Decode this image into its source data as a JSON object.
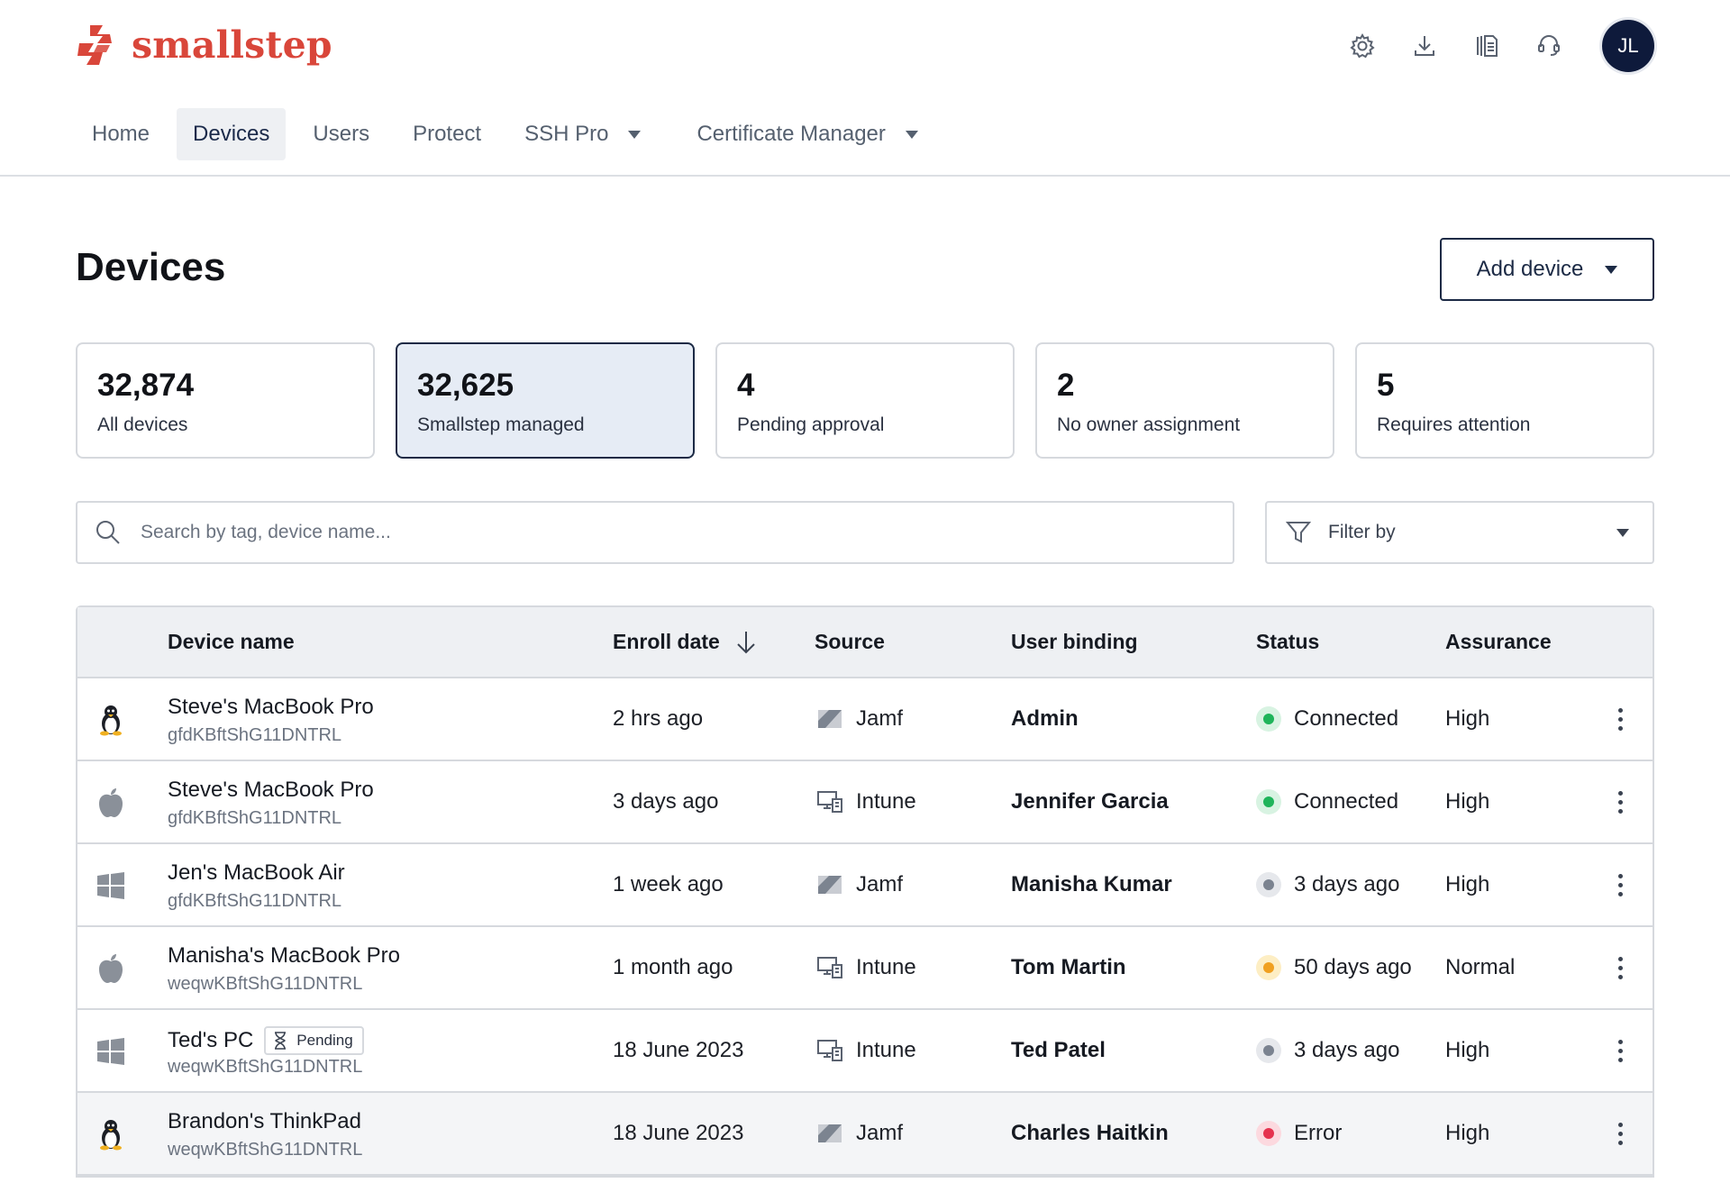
{
  "brand": {
    "name": "smallstep",
    "color": "#d9463a"
  },
  "header": {
    "icons": [
      "gear-icon",
      "download-icon",
      "docs-icon",
      "support-icon"
    ],
    "avatar_initials": "JL"
  },
  "nav": {
    "items": [
      {
        "label": "Home"
      },
      {
        "label": "Devices"
      },
      {
        "label": "Users"
      },
      {
        "label": "Protect"
      },
      {
        "label": "SSH Pro"
      },
      {
        "label": "Certificate Manager"
      }
    ],
    "active": "Devices"
  },
  "page": {
    "title": "Devices",
    "add_device_label": "Add device"
  },
  "stats": [
    {
      "value": "32,874",
      "label": "All devices"
    },
    {
      "value": "32,625",
      "label": "Smallstep managed"
    },
    {
      "value": "4",
      "label": "Pending approval"
    },
    {
      "value": "2",
      "label": "No owner assignment"
    },
    {
      "value": "5",
      "label": "Requires attention"
    }
  ],
  "search": {
    "placeholder": "Search by tag, device name..."
  },
  "filter": {
    "label": "Filter by"
  },
  "table": {
    "columns": {
      "device_name": "Device name",
      "enroll_date": "Enroll date",
      "source": "Source",
      "user_binding": "User binding",
      "status": "Status",
      "assurance": "Assurance"
    },
    "rows": [
      {
        "os": "linux-icon",
        "name": "Steve's MacBook Pro",
        "id": "gfdKBftShG11DNTRL",
        "badge": "",
        "enroll": "2 hrs ago",
        "source": "Jamf",
        "user": "Admin",
        "status": "Connected",
        "status_color": "#1fb45a",
        "assurance": "High"
      },
      {
        "os": "apple-icon",
        "name": "Steve's MacBook Pro",
        "id": "gfdKBftShG11DNTRL",
        "badge": "",
        "enroll": "3 days ago",
        "source": "Intune",
        "user": "Jennifer Garcia",
        "status": "Connected",
        "status_color": "#1fb45a",
        "assurance": "High"
      },
      {
        "os": "windows-icon",
        "name": "Jen's MacBook Air",
        "id": "gfdKBftShG11DNTRL",
        "badge": "",
        "enroll": "1 week ago",
        "source": "Jamf",
        "user": "Manisha Kumar",
        "status": "3 days ago",
        "status_color": "#7b8390",
        "assurance": "High"
      },
      {
        "os": "apple-icon",
        "name": "Manisha's MacBook Pro",
        "id": "weqwKBftShG11DNTRL",
        "badge": "",
        "enroll": "1 month ago",
        "source": "Intune",
        "user": "Tom Martin",
        "status": "50 days ago",
        "status_color": "#f0a020",
        "assurance": "Normal"
      },
      {
        "os": "windows-icon",
        "name": "Ted's PC",
        "id": "weqwKBftShG11DNTRL",
        "badge": "Pending",
        "enroll": "18 June 2023",
        "source": "Intune",
        "user": "Ted Patel",
        "status": "3 days ago",
        "status_color": "#7b8390",
        "assurance": "High"
      },
      {
        "os": "linux-icon",
        "name": "Brandon's ThinkPad",
        "id": "weqwKBftShG11DNTRL",
        "badge": "",
        "enroll": "18 June 2023",
        "source": "Jamf",
        "user": "Charles Haitkin",
        "status": "Error",
        "status_color": "#e5334f",
        "assurance": "High"
      }
    ]
  }
}
